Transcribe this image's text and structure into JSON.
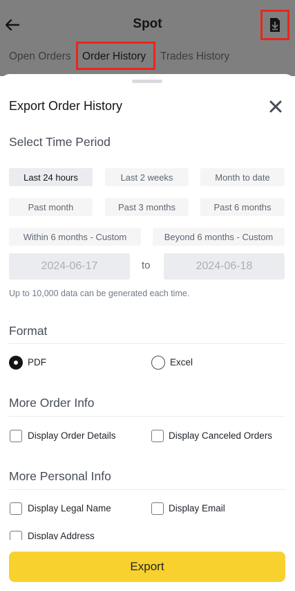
{
  "header": {
    "title": "Spot",
    "tabs": [
      "Open Orders",
      "Order History",
      "Trades History"
    ]
  },
  "sheet": {
    "title": "Export Order History",
    "time_period": {
      "title": "Select Time Period",
      "options": [
        "Last 24 hours",
        "Last 2 weeks",
        "Month to date",
        "Past month",
        "Past 3 months",
        "Past 6 months",
        "Within 6 months - Custom",
        "Beyond 6 months - Custom"
      ],
      "selected": "Last 24 hours",
      "start_date": "2024-06-17",
      "to_label": "to",
      "end_date": "2024-06-18",
      "hint": "Up to 10,000 data can be generated each time."
    },
    "format": {
      "title": "Format",
      "options": [
        "PDF",
        "Excel"
      ],
      "selected": "PDF"
    },
    "order_info": {
      "title": "More Order Info",
      "options": [
        "Display Order Details",
        "Display Canceled Orders"
      ]
    },
    "personal_info": {
      "title": "More Personal Info",
      "options": [
        "Display Legal Name",
        "Display Email",
        "Display Address"
      ]
    },
    "export_label": "Export"
  },
  "colors": {
    "accent": "#F8D12F",
    "highlight": "#E8261B",
    "overlay": "#7F7F7F"
  }
}
